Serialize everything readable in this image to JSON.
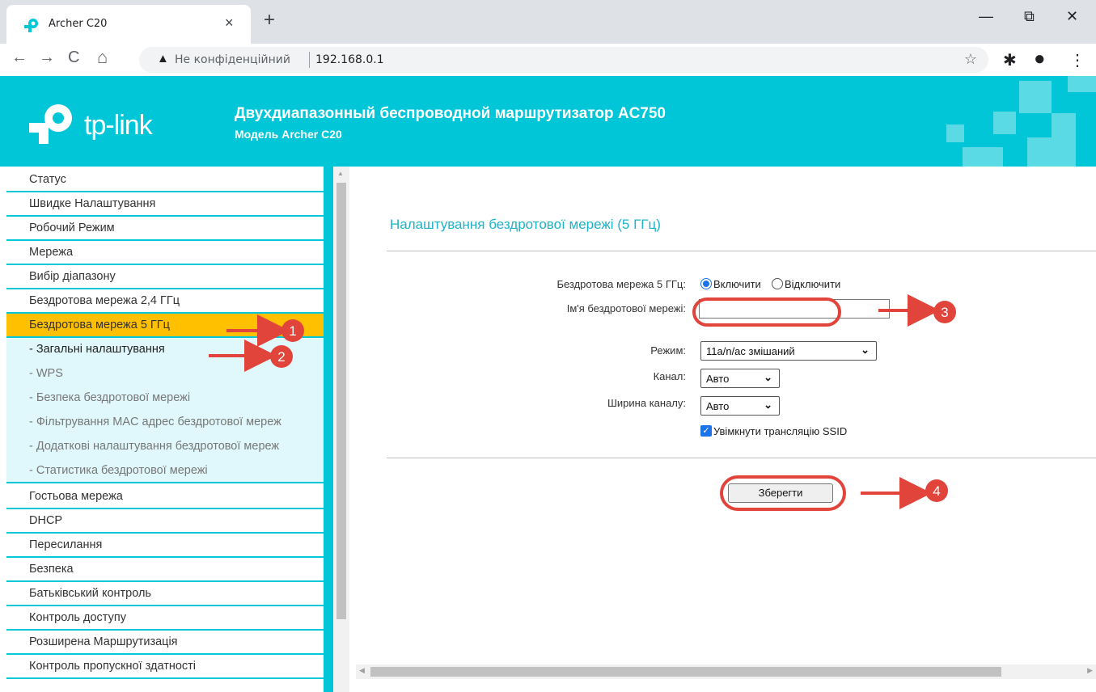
{
  "browser": {
    "tab_title": "Archer C20",
    "tab_close": "×",
    "new_tab": "+",
    "win_minimize": "—",
    "win_restore": "⧉",
    "win_close": "✕",
    "back": "←",
    "forward": "→",
    "reload": "C",
    "home": "⌂",
    "security_warning_icon": "▲",
    "security_text": "Не конфіденційний",
    "url": "192.168.0.1",
    "bookmark_star": "☆",
    "extensions": "✱",
    "profile": "●",
    "menu": "⋮"
  },
  "header": {
    "brand": "tp-link",
    "title": "Двухдиапазонный беспроводной маршрутизатор AC750",
    "subtitle": "Модель Archer C20"
  },
  "sidebar": {
    "items_top": [
      {
        "label": "Статус"
      },
      {
        "label": "Швидке Налаштування"
      },
      {
        "label": "Робочий Режим"
      },
      {
        "label": "Мережа"
      },
      {
        "label": "Вибір діапазону"
      },
      {
        "label": "Бездротова мережа 2,4 ГГц"
      },
      {
        "label": "Бездротова мережа 5 ГГц"
      }
    ],
    "sub_items": [
      {
        "label": "- Загальні налаштування"
      },
      {
        "label": "- WPS"
      },
      {
        "label": "- Безпека бездротової мережі"
      },
      {
        "label": "- Фільтрування MAC адрес бездротової мереж"
      },
      {
        "label": "- Додаткові налаштування бездротової мереж"
      },
      {
        "label": "- Статистика бездротової мережі"
      }
    ],
    "items_bottom": [
      {
        "label": "Гостьова мережа"
      },
      {
        "label": "DHCP"
      },
      {
        "label": "Пересилання"
      },
      {
        "label": "Безпека"
      },
      {
        "label": "Батьківський контроль"
      },
      {
        "label": "Контроль доступу"
      },
      {
        "label": "Розширена Маршрутизація"
      },
      {
        "label": "Контроль пропускної здатності"
      }
    ]
  },
  "content": {
    "title": "Налаштування бездротової мережі (5 ГГц)",
    "wireless_label": "Бездротова мережа 5 ГГц:",
    "enable_label": "Включити",
    "disable_label": "Відключити",
    "ssid_label": "Ім'я бездротової мережі:",
    "ssid_value": "",
    "mode_label": "Режим:",
    "mode_value": "11a/n/ac змішаний",
    "channel_label": "Канал:",
    "channel_value": "Авто",
    "width_label": "Ширина каналу:",
    "width_value": "Авто",
    "ssid_broadcast_label": "Увімкнути трансляцію SSID",
    "ssid_broadcast_checked": true,
    "save_label": "Зберегти"
  },
  "annotations": {
    "markers": [
      "1",
      "2",
      "3",
      "4"
    ],
    "color": "#e0443a"
  },
  "colors": {
    "brand": "#00c6d8",
    "active_menu": "#ffc000",
    "submenu_bg": "#e0f8fb",
    "title_text": "#1fb2c8"
  }
}
